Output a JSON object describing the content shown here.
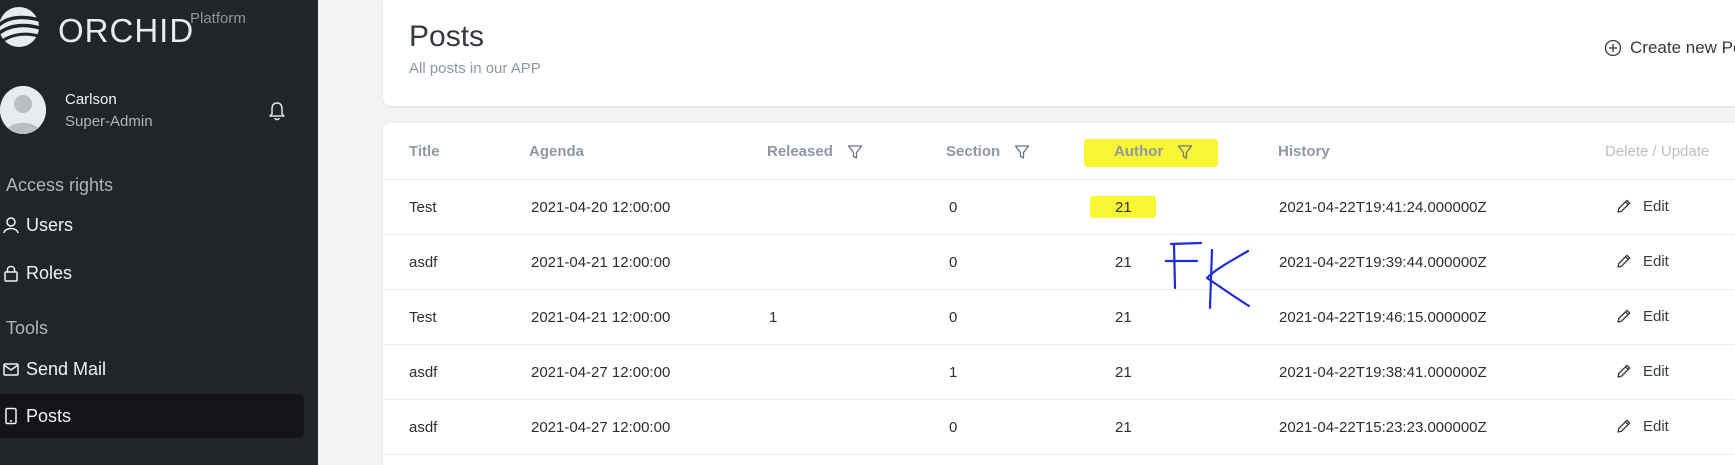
{
  "brand": {
    "name": "ORCHID",
    "subtitle": "Platform"
  },
  "user": {
    "name": "Carlson",
    "role": "Super-Admin"
  },
  "sidebar": {
    "sections": [
      {
        "heading": "Access rights",
        "items": [
          {
            "label": "Users",
            "icon": "user-icon"
          },
          {
            "label": "Roles",
            "icon": "lock-icon"
          }
        ]
      },
      {
        "heading": "Tools",
        "items": [
          {
            "label": "Send Mail",
            "icon": "mail-icon"
          },
          {
            "label": "Posts",
            "icon": "phone-icon",
            "active": true
          }
        ]
      }
    ]
  },
  "header": {
    "title": "Posts",
    "subtitle": "All posts in our APP",
    "create_label": "Create new Po"
  },
  "table": {
    "columns": [
      "Title",
      "Agenda",
      "Released",
      "Section",
      "Author",
      "History",
      "Delete / Update"
    ],
    "rows": [
      {
        "title": "Test",
        "agenda": "2021-04-20 12:00:00",
        "released": "",
        "section": "0",
        "author": "21",
        "history": "2021-04-22T19:41:24.000000Z",
        "action": "Edit"
      },
      {
        "title": "asdf",
        "agenda": "2021-04-21 12:00:00",
        "released": "",
        "section": "0",
        "author": "21",
        "history": "2021-04-22T19:39:44.000000Z",
        "action": "Edit"
      },
      {
        "title": "Test",
        "agenda": "2021-04-21 12:00:00",
        "released": "1",
        "section": "0",
        "author": "21",
        "history": "2021-04-22T19:46:15.000000Z",
        "action": "Edit"
      },
      {
        "title": "asdf",
        "agenda": "2021-04-27 12:00:00",
        "released": "",
        "section": "1",
        "author": "21",
        "history": "2021-04-22T19:38:41.000000Z",
        "action": "Edit"
      },
      {
        "title": "asdf",
        "agenda": "2021-04-27 12:00:00",
        "released": "",
        "section": "0",
        "author": "21",
        "history": "2021-04-22T15:23:23.000000Z",
        "action": "Edit"
      }
    ]
  },
  "annotation": {
    "handwritten_text": "FK",
    "highlight_color": "#f9f733",
    "ink_color": "#1f2bd6"
  }
}
